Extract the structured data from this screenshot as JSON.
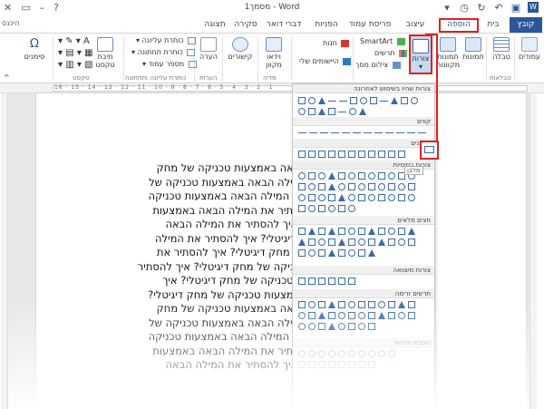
{
  "window": {
    "title": "מסמך1 - Word",
    "sign_in": "היכנס",
    "help": "?",
    "minimize": "–",
    "restore": "▭",
    "close": "✕"
  },
  "tabs": {
    "file": "קובץ",
    "home": "בית",
    "insert": "הוספה",
    "design": "עיצוב",
    "layout": "פריסת עמוד",
    "references": "הפניות",
    "mailings": "דברי דואר",
    "review": "סקירה",
    "view": "תצוגה"
  },
  "ribbon": {
    "pages": "עמודים",
    "table": "טבלה",
    "tables_group": "טבלאות",
    "pictures": "תמונות",
    "online_pictures": "תמונות מקוונות",
    "shapes": "צורות",
    "smartart": "SmartArt",
    "chart": "תרשים",
    "screenshot": "צילום מסך",
    "store": "חנות",
    "my_apps": "היישומים שלי",
    "online_video": "וידאו מקוון",
    "media_group": "מדיה",
    "links": "קישורים",
    "comment": "הערה",
    "comments_group": "הערות",
    "header": "כותרת עליונה",
    "footer": "כותרת תחתונה",
    "page_number": "מספר עמוד",
    "header_footer_group": "כותרת עליונה ותחתונה",
    "text_box": "תיבת טקסט",
    "text_group": "טקסט",
    "symbols": "סימנים"
  },
  "ruler": {
    "numbers": "16 · 15 · 14 · 13 · 12 · 11 · 10 · 9 · 8 · 7 · 6 · 5 · 4 · 3 · 2 · 1"
  },
  "gallery": {
    "recent": "צורות שהיו בשימוש לאחרונה",
    "lines": "קווים",
    "rectangles": "מלבנים",
    "rect_tooltip": "מלבן",
    "basic": "צורות בסיסיות",
    "block_arrows": "חצים מלאים",
    "equation": "צורות משוואה",
    "flowchart": "תרשים זרימה",
    "stars": "כוכבים וכרזות"
  },
  "document": {
    "lines": [
      "הבאה באמצעות טכניקה של מחק",
      "המילה הבאה באמצעות טכניקה של",
      "את המילה הבאה באמצעות טכניקה",
      "הסתיר את המילה הבאה באמצעות",
      "? איך להסתיר את המילה הבאה",
      "ק דיגיטלי? איך להסתיר את המילה",
      "של מחק דיגיטלי? איך להסתיר את",
      "טכניקה של מחק דיגיטלי? איך להסתיר",
      "ות טכניקה של מחק דיגיטלי? איך",
      "באמצעות טכניקה של מחק דיגיטלי?",
      "הבאה באמצעות טכניקה של מחק",
      "המילה הבאה באמצעות טכניקה של",
      "את המילה הבאה באמצעות טכניקה",
      "הסתיר את המילה הבאה באמצעות",
      "? איך להסתיר את המילה הבאה"
    ]
  },
  "colors": {
    "file_tab": "#2b579a",
    "highlight": "#e02020",
    "shape_stroke": "#3c6aa8"
  }
}
